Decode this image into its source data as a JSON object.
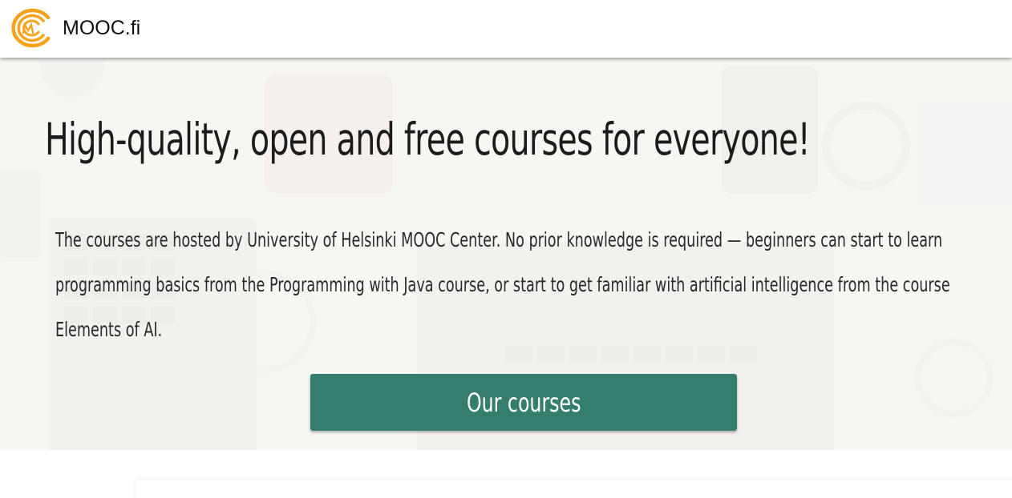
{
  "header": {
    "logo_text": "MOOC.fi",
    "logo_icon": "mooc-logo-icon",
    "accent_color": "#f6a31b"
  },
  "hero": {
    "title": "High-quality, open and free courses for everyone!",
    "description": "The courses are hosted by University of Helsinki MOOC Center. No prior knowledge is required — beginners can start to learn programming basics from the Programming with Java course, or start to get familiar with artificial intelligence from the course Elements of AI.",
    "button_label": "Our courses",
    "button_color": "#357e6d"
  }
}
